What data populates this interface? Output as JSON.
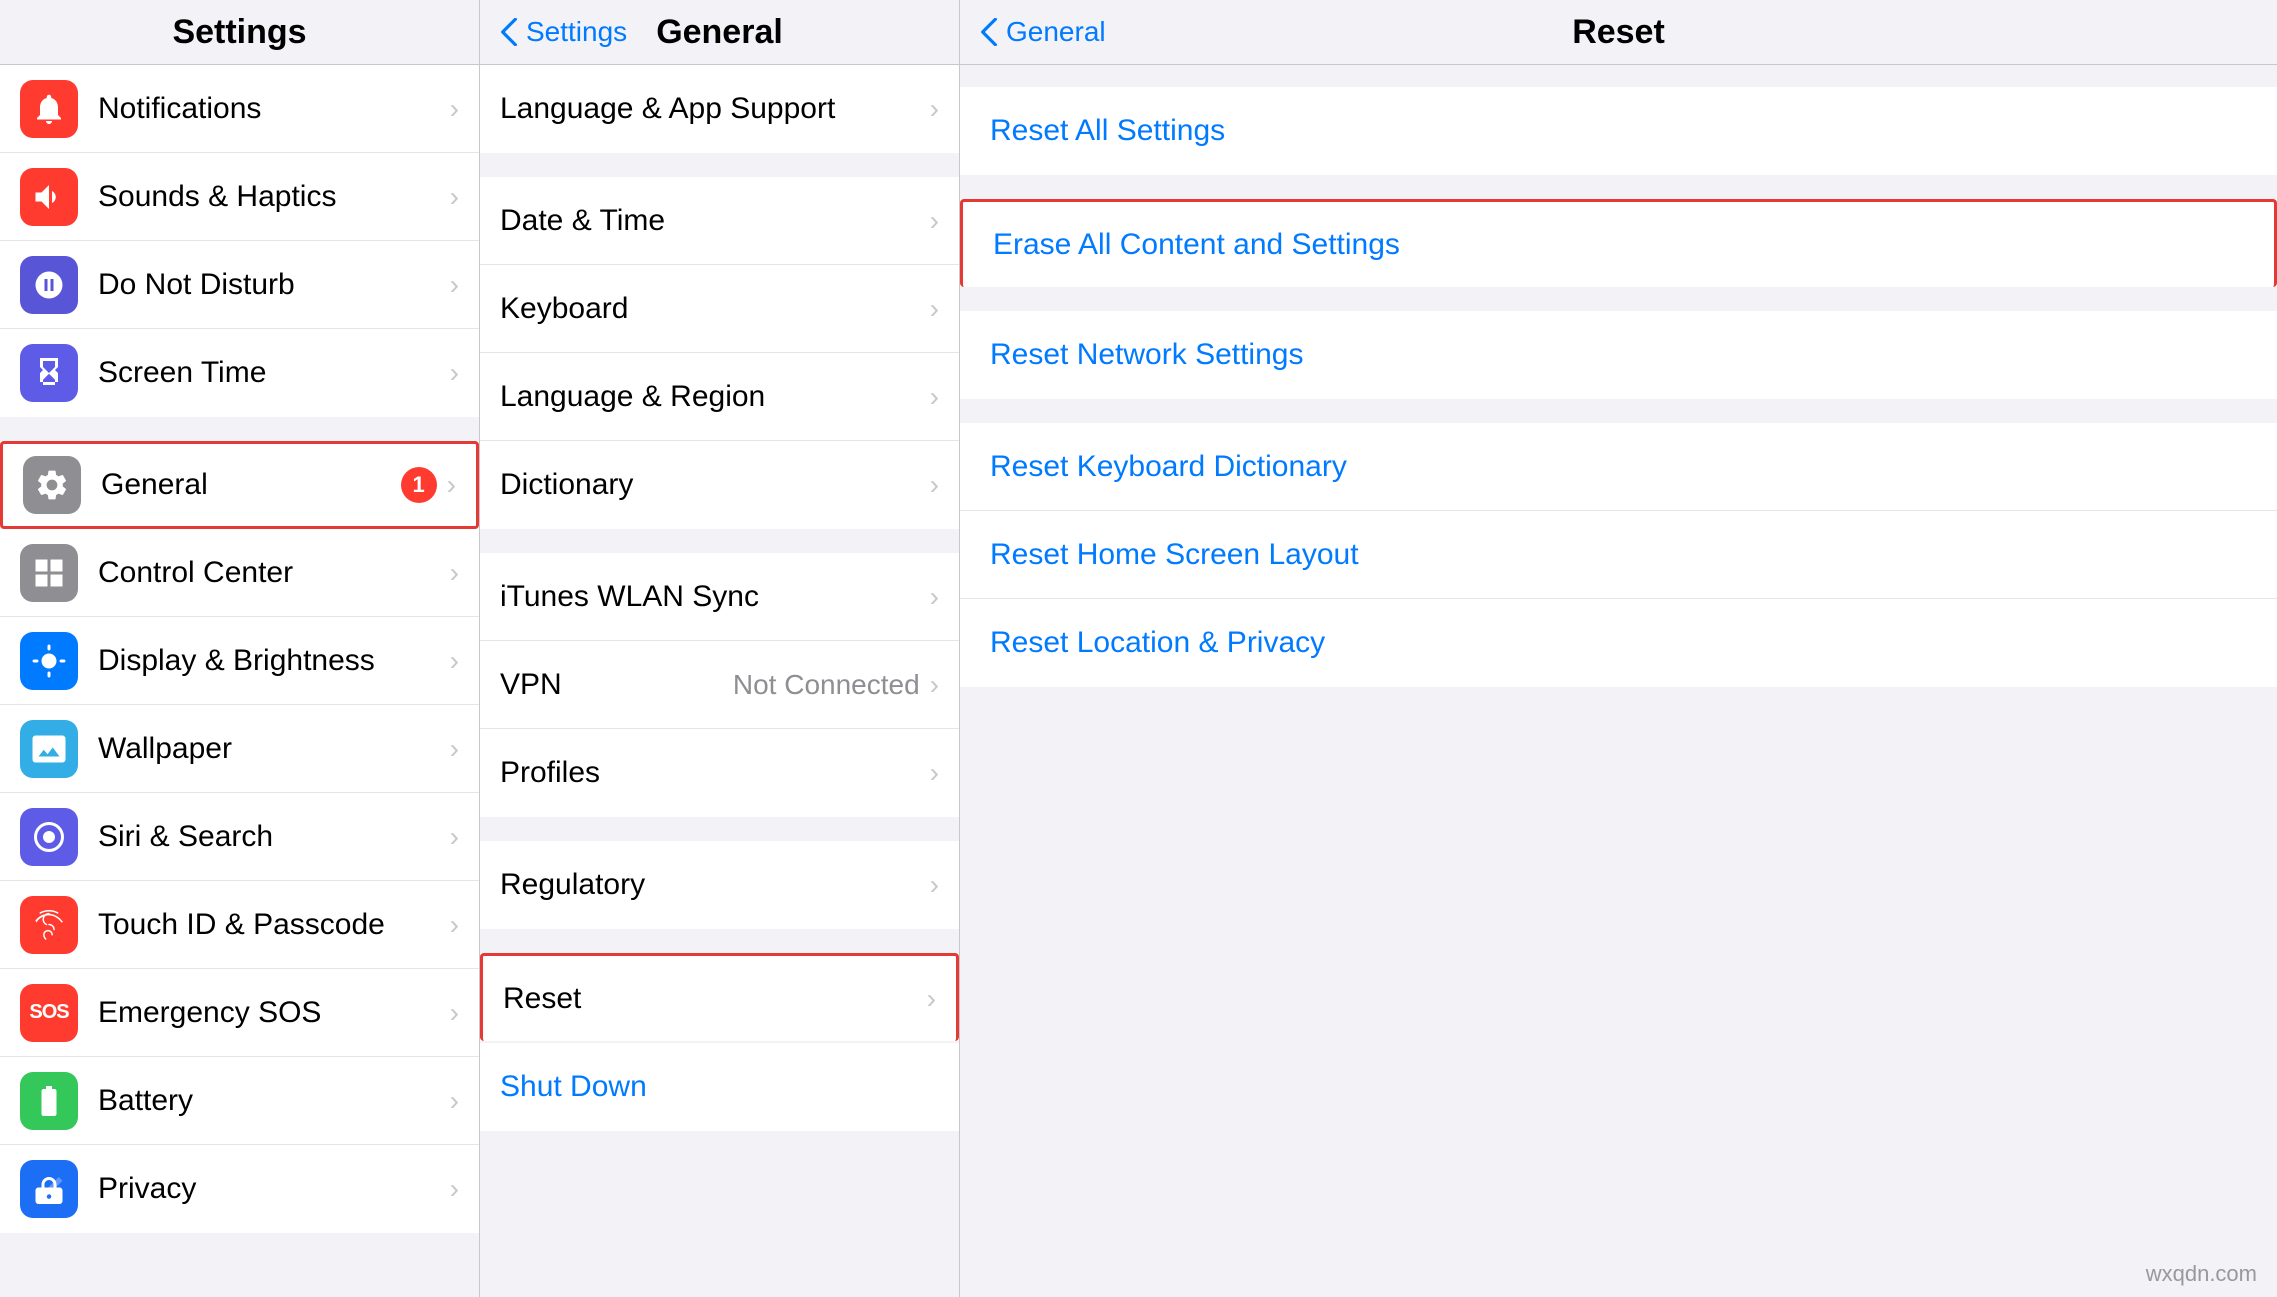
{
  "colors": {
    "accent": "#007aff",
    "red": "#ff3b30",
    "highlight_border": "#e53935",
    "text_primary": "#000",
    "text_secondary": "#8e8e93",
    "text_blue": "#007aff",
    "bg_main": "#f2f2f7",
    "bg_white": "#fff"
  },
  "settings_column": {
    "title": "Settings",
    "items_group1": [
      {
        "id": "notifications",
        "label": "Notifications",
        "icon_color": "#ff3b30",
        "icon": "bell"
      },
      {
        "id": "sounds",
        "label": "Sounds & Haptics",
        "icon_color": "#ff3b30",
        "icon": "speaker"
      },
      {
        "id": "donotdisturb",
        "label": "Do Not Disturb",
        "icon_color": "#5856d6",
        "icon": "moon"
      },
      {
        "id": "screentime",
        "label": "Screen Time",
        "icon_color": "#5e5ce6",
        "icon": "hourglass"
      }
    ],
    "items_group2": [
      {
        "id": "general",
        "label": "General",
        "icon_color": "#8e8e93",
        "icon": "gear",
        "badge": "1",
        "selected": true
      },
      {
        "id": "controlcenter",
        "label": "Control Center",
        "icon_color": "#8e8e93",
        "icon": "switches"
      },
      {
        "id": "displaybrightness",
        "label": "Display & Brightness",
        "icon_color": "#007aff",
        "icon": "sun"
      },
      {
        "id": "wallpaper",
        "label": "Wallpaper",
        "icon_color": "#32ade6",
        "icon": "photo"
      },
      {
        "id": "sirisearch",
        "label": "Siri & Search",
        "icon_color": "#5e5ce6",
        "icon": "siri"
      },
      {
        "id": "touchid",
        "label": "Touch ID & Passcode",
        "icon_color": "#ff3b30",
        "icon": "fingerprint"
      },
      {
        "id": "emergencysos",
        "label": "Emergency SOS",
        "icon_color": "#ff3b30",
        "icon": "sos"
      },
      {
        "id": "battery",
        "label": "Battery",
        "icon_color": "#34c759",
        "icon": "battery"
      },
      {
        "id": "privacy",
        "label": "Privacy",
        "icon_color": "#1c6ef5",
        "icon": "hand"
      }
    ]
  },
  "general_column": {
    "back_label": "Settings",
    "title": "General",
    "top_partial_label": "Language & App Support",
    "items_group1": [
      {
        "id": "datetime",
        "label": "Date & Time"
      },
      {
        "id": "keyboard",
        "label": "Keyboard"
      },
      {
        "id": "languageregion",
        "label": "Language & Region"
      },
      {
        "id": "dictionary",
        "label": "Dictionary"
      }
    ],
    "items_group2": [
      {
        "id": "ituneswlan",
        "label": "iTunes WLAN Sync"
      },
      {
        "id": "vpn",
        "label": "VPN",
        "value": "Not Connected"
      },
      {
        "id": "profiles",
        "label": "Profiles"
      }
    ],
    "items_group3": [
      {
        "id": "regulatory",
        "label": "Regulatory"
      }
    ],
    "items_group4": [
      {
        "id": "reset",
        "label": "Reset",
        "selected": true
      }
    ],
    "items_group5": [
      {
        "id": "shutdown",
        "label": "Shut Down",
        "is_blue": true
      }
    ]
  },
  "reset_column": {
    "back_label": "General",
    "title": "Reset",
    "items_group1": [
      {
        "id": "resetallsettings",
        "label": "Reset All Settings"
      }
    ],
    "items_group2": [
      {
        "id": "eraseallcontent",
        "label": "Erase All Content and Settings",
        "highlighted": true
      }
    ],
    "items_group3": [
      {
        "id": "resetnetwork",
        "label": "Reset Network Settings"
      }
    ],
    "items_group4": [
      {
        "id": "resetkeyboard",
        "label": "Reset Keyboard Dictionary"
      },
      {
        "id": "resethomescreen",
        "label": "Reset Home Screen Layout"
      },
      {
        "id": "resetlocation",
        "label": "Reset Location & Privacy"
      }
    ]
  },
  "watermark": "wxqdn.com"
}
